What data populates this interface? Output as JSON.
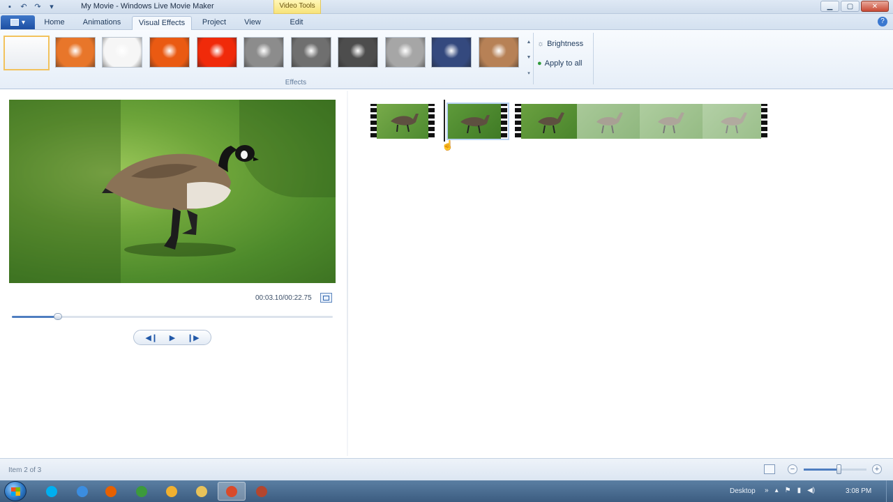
{
  "window": {
    "title": "My Movie - Windows Live Movie Maker",
    "contextual_tab_group": "Video Tools",
    "controls": {
      "minimize": "▁",
      "maximize": "▢",
      "close": "✕"
    }
  },
  "quick_access": {
    "save": "▪",
    "undo": "↶",
    "redo": "↷",
    "customize": "▾"
  },
  "tabs": [
    {
      "label": "Home"
    },
    {
      "label": "Animations"
    },
    {
      "label": "Visual Effects"
    },
    {
      "label": "Project"
    },
    {
      "label": "View"
    },
    {
      "label": "Edit"
    }
  ],
  "active_tab": "Visual Effects",
  "help_label": "?",
  "ribbon": {
    "effects_group_label": "Effects",
    "brightness_label": "Brightness",
    "apply_to_all_label": "Apply to all",
    "effects": [
      {
        "name": "No effect",
        "color": "#f2f4f7"
      },
      {
        "name": "Warm",
        "color": "#e8762a"
      },
      {
        "name": "Edge",
        "color": "#f6f6f6"
      },
      {
        "name": "Orange",
        "color": "#ea5a12"
      },
      {
        "name": "Threshold",
        "color": "#f02a0a"
      },
      {
        "name": "Black and white",
        "color": "#8c8c8c"
      },
      {
        "name": "Grey",
        "color": "#6f6f6f"
      },
      {
        "name": "Dark",
        "color": "#4d4d4d"
      },
      {
        "name": "Light",
        "color": "#a6a6a6"
      },
      {
        "name": "Blue",
        "color": "#34497e"
      },
      {
        "name": "Sepia",
        "color": "#b78156"
      }
    ]
  },
  "preview": {
    "timecode": "00:03.10/00:22.75",
    "seek_fraction": 0.143,
    "controls": {
      "previous_frame": "◀❙",
      "play": "▶",
      "next_frame": "❙▶"
    }
  },
  "storyboard": {
    "clips": [
      {
        "name": "Clip 1",
        "selected": false,
        "faded": false
      },
      {
        "name": "Clip 2",
        "selected": true,
        "faded": false
      },
      {
        "name": "Clip 3",
        "selected": false,
        "faded": false
      }
    ]
  },
  "status": {
    "item_text": "Item 2 of 3",
    "zoom_fraction": 0.55
  },
  "taskbar": {
    "desktop_label": "Desktop",
    "clock": "3:08 PM",
    "pinned": [
      {
        "name": "skype",
        "color": "#00aff0"
      },
      {
        "name": "internet-explorer",
        "color": "#3b8de0"
      },
      {
        "name": "firefox",
        "color": "#e66000"
      },
      {
        "name": "chrome",
        "color": "#3c9a3c"
      },
      {
        "name": "messenger",
        "color": "#f0b030"
      },
      {
        "name": "explorer",
        "color": "#e8c25a"
      },
      {
        "name": "movie-maker",
        "color": "#d94a2a"
      },
      {
        "name": "powerpoint",
        "color": "#b3462e"
      }
    ],
    "tray_icons": [
      "»",
      "▴",
      "⚑",
      "▮",
      "◀)"
    ]
  }
}
